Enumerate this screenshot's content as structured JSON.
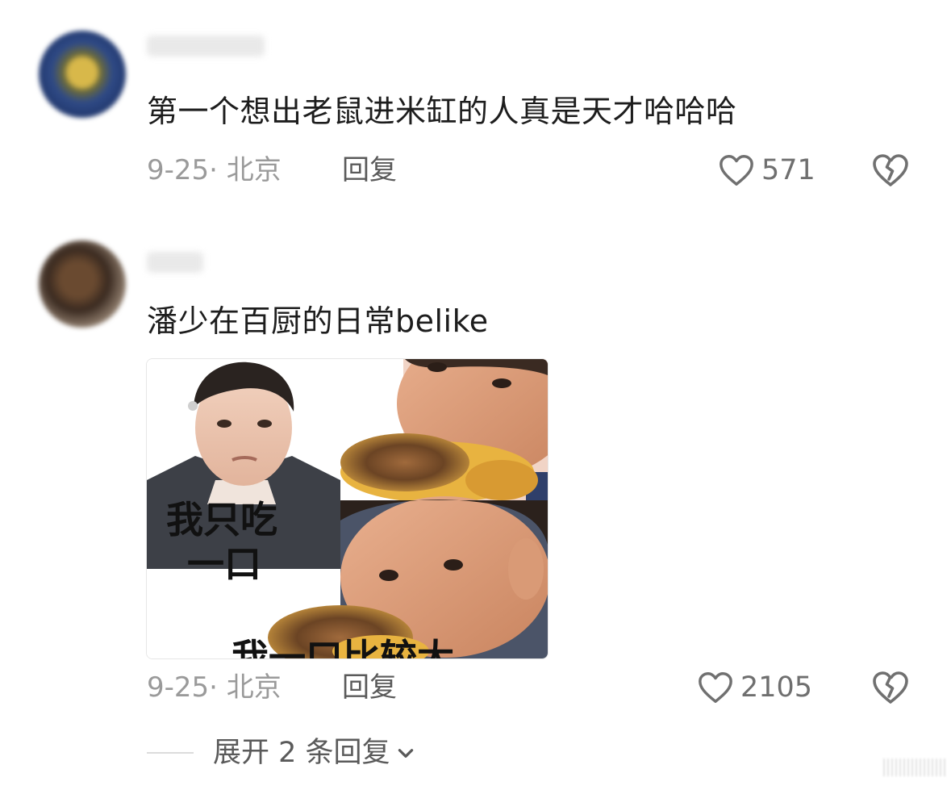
{
  "comments": [
    {
      "text": "第一个想出老鼠进米缸的人真是天才哈哈哈",
      "date_location": "9-25· 北京",
      "reply_label": "回复",
      "likes": "571"
    },
    {
      "text": "潘少在百厨的日常belike",
      "date_location": "9-25· 北京",
      "reply_label": "回复",
      "likes": "2105",
      "meme": {
        "caption_top": "我只吃\n一口",
        "caption_bottom": "我一口比较大"
      }
    }
  ],
  "expand_replies": {
    "label": "展开 2 条回复"
  },
  "icons": {
    "like": "heart-outline-icon",
    "dislike": "broken-heart-icon",
    "expand": "chevron-down-icon"
  },
  "colors": {
    "text": "#1d1d1d",
    "meta": "#9a9a9a",
    "icon": "#6f6f6f"
  }
}
